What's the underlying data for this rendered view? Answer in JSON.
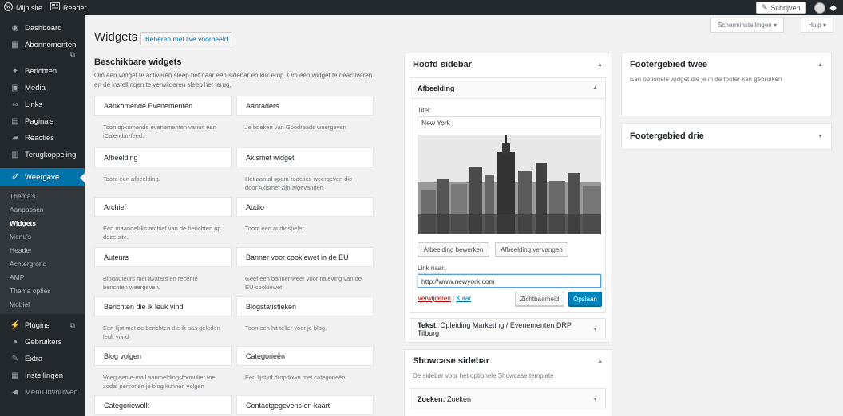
{
  "adminbar": {
    "site_name": "Mijn site",
    "reader_label": "Reader",
    "write_label": "Schrijven"
  },
  "sidebar": {
    "items": [
      {
        "icon": "dashboard-icon",
        "label": "Dashboard"
      },
      {
        "icon": "cart-icon",
        "label": "Abonnementen"
      },
      {
        "icon": "pin-icon",
        "label": "Berichten"
      },
      {
        "icon": "media-icon",
        "label": "Media"
      },
      {
        "icon": "links-icon",
        "label": "Links"
      },
      {
        "icon": "pages-icon",
        "label": "Pagina's"
      },
      {
        "icon": "comments-icon",
        "label": "Reacties"
      },
      {
        "icon": "feedback-icon",
        "label": "Terugkoppeling"
      },
      {
        "icon": "appearance-icon",
        "label": "Weergave"
      },
      {
        "icon": "plugins-icon",
        "label": "Plugins"
      },
      {
        "icon": "users-icon",
        "label": "Gebruikers"
      },
      {
        "icon": "tools-icon",
        "label": "Extra"
      },
      {
        "icon": "settings-icon",
        "label": "Instellingen"
      },
      {
        "icon": "collapse-icon",
        "label": "Menu invouwen"
      }
    ],
    "submenu": [
      "Thema's",
      "Aanpassen",
      "Widgets",
      "Menu's",
      "Header",
      "Achtergrond",
      "AMP",
      "Thema opties",
      "Mobiel"
    ]
  },
  "header": {
    "screen_options": "Scherminstellingen",
    "help": "Hulp",
    "title": "Widgets",
    "live_button": "Beheren met live voorbeeld"
  },
  "available": {
    "title": "Beschikbare widgets",
    "description": "Om een widget te activeren sleep het naar een sidebar en klik erop. Om een widget te deactiveren en de instellingen te verwijderen sleep het terug.",
    "widgets": [
      {
        "name": "Aankomende Evenementen",
        "desc": "Toon opkomende evenementen vanuit een iCalendar-feed."
      },
      {
        "name": "Aanraders",
        "desc": "Je boeken van Goodreads weergeven"
      },
      {
        "name": "Afbeelding",
        "desc": "Toont een afbeelding."
      },
      {
        "name": "Akismet widget",
        "desc": "Het aantal spam-reacties weergeven die door Akismet zijn afgevangen"
      },
      {
        "name": "Archief",
        "desc": "Een maandelijks archief van de berichten op deze site."
      },
      {
        "name": "Audio",
        "desc": "Toont een audiospeler."
      },
      {
        "name": "Auteurs",
        "desc": "Blogauteurs met avatars en recente berichten weergeven."
      },
      {
        "name": "Banner voor cookiewet in de EU",
        "desc": "Geef een banner weer voor naleving van de EU-cookiewet"
      },
      {
        "name": "Berichten die ik leuk vind",
        "desc": "Een lijst met de berichten die ik pas geleden leuk vond"
      },
      {
        "name": "Blogstatistieken",
        "desc": "Toon een hit teller voor je blog."
      },
      {
        "name": "Blog volgen",
        "desc": "Voeg een e-mail aanmeldingsformulier toe zodat personen je blog kunnen volgen"
      },
      {
        "name": "Categorieën",
        "desc": "Een lijst of dropdown met categorieën."
      },
      {
        "name": "Categoriewolk",
        "desc": ""
      },
      {
        "name": "Contactgegevens en kaart",
        "desc": ""
      }
    ]
  },
  "main_sidebar": {
    "title": "Hoofd sidebar",
    "image_widget": {
      "title": "Afbeelding",
      "title_label": "Titel:",
      "title_value": "New York",
      "edit_button": "Afbeelding bewerken",
      "replace_button": "Afbeelding vervangen",
      "link_label": "Link naar:",
      "link_value": "http://www.newyork.com",
      "remove_link": "Verwijderen",
      "separator": "|",
      "done_link": "Klaar",
      "visibility_button": "Zichtbaarheid",
      "save_button": "Opslaan"
    },
    "text_widget": {
      "type": "Tekst",
      "title": "Opleiding Marketing / Evenementen DRP Tilburg"
    }
  },
  "showcase_sidebar": {
    "title": "Showcase sidebar",
    "description": "De sidebar voor het optionele Showcase template",
    "search_widget": {
      "type": "Zoeken",
      "title": "Zoeken"
    }
  },
  "footer_two": {
    "title": "Footergebied twee",
    "description": "Een optionele widget die je in de footer kan gebruiken"
  },
  "footer_three": {
    "title": "Footergebied drie"
  },
  "colors": {
    "admin_dark": "#23282d",
    "accent": "#0073aa",
    "primary_button": "#0085ba"
  }
}
